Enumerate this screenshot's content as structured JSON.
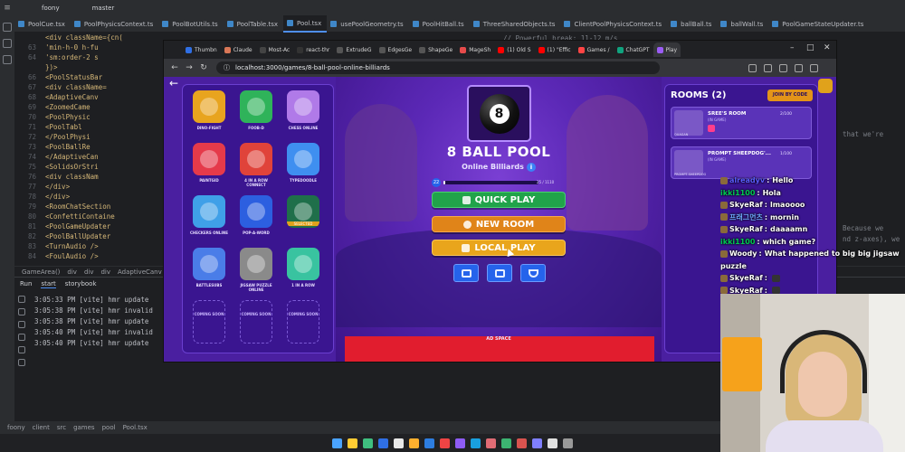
{
  "ide": {
    "project": "foony",
    "branch": "master",
    "tabs": [
      "PoolCue.tsx",
      "PoolPhysicsContext.ts",
      "PoolBotUtils.ts",
      "PoolTable.tsx",
      "Pool.tsx",
      "usePoolGeometry.ts",
      "PoolHitBall.ts",
      "ThreeSharedObjects.ts",
      "ClientPoolPhysicsContext.ts",
      "ballBall.ts",
      "ballWall.ts",
      "PoolGameStateUpdater.ts"
    ],
    "active_tab": "Pool.tsx",
    "code_lines": [
      {
        "n": "",
        "t": "<div className={cn("
      },
      {
        "n": "63",
        "t": "  'min-h-0 h-fu"
      },
      {
        "n": "64",
        "t": "  'sm:order-2 s"
      },
      {
        "n": "",
        "t": "})>"
      },
      {
        "n": "66",
        "t": "  <PoolStatusBar"
      },
      {
        "n": "67",
        "t": "  <div className="
      },
      {
        "n": "68",
        "t": "    <AdaptiveCanv"
      },
      {
        "n": "69",
        "t": "      <ZoomedCame"
      },
      {
        "n": "70",
        "t": "      <PoolPhysic"
      },
      {
        "n": "71",
        "t": "        <PoolTabl"
      },
      {
        "n": "72",
        "t": "      </PoolPhysi"
      },
      {
        "n": "73",
        "t": "      <PoolBallRe"
      },
      {
        "n": "74",
        "t": "    </AdaptiveCan"
      },
      {
        "n": "75",
        "t": "    <SolidsOrStri"
      },
      {
        "n": "76",
        "t": "    <div classNam"
      },
      {
        "n": "77",
        "t": "  </div>"
      },
      {
        "n": "78",
        "t": "</div>"
      },
      {
        "n": "79",
        "t": "<RoomChatSection"
      },
      {
        "n": "80",
        "t": "<ConfettiContaine"
      },
      {
        "n": "81",
        "t": "<PoolGameUpdater"
      },
      {
        "n": "82",
        "t": "<PoolBallUpdater"
      },
      {
        "n": "83",
        "t": "<TurnAudio />"
      },
      {
        "n": "84",
        "t": "<FoulAudio />"
      }
    ],
    "code_comment": "// Powerful break: 11-12 m/s",
    "side_text": [
      "that we're",
      "Because we",
      "nd z-axes), we",
      "s"
    ],
    "breadcrumb": [
      "GameArea()",
      "div",
      "div",
      "div",
      "AdaptiveCanv"
    ],
    "run_tabs": [
      "Run",
      "start",
      "storybook"
    ],
    "log_lines": [
      "3:05:33 PM [vite] hmr update",
      "3:05:38 PM [vite] hmr invalid",
      "3:05:38 PM [vite] hmr update",
      "3:05:40 PM [vite] hmr invalid",
      "3:05:40 PM [vite] hmr update"
    ],
    "status_path": [
      "foony",
      "client",
      "src",
      "games",
      "pool",
      "Pool.tsx"
    ]
  },
  "browser": {
    "tabs": [
      {
        "label": "Thumbn",
        "color": "#2f6fe4"
      },
      {
        "label": "Claude",
        "color": "#d97757"
      },
      {
        "label": "Most-Ac",
        "color": "#444444"
      },
      {
        "label": "react-thr",
        "color": "#333333"
      },
      {
        "label": "ExtrudeG",
        "color": "#555555"
      },
      {
        "label": "EdgesGe",
        "color": "#555555"
      },
      {
        "label": "ShapeGe",
        "color": "#555555"
      },
      {
        "label": "MageSh",
        "color": "#e64b4b"
      },
      {
        "label": "(1) Old S",
        "color": "#ff0000"
      },
      {
        "label": "(1) \"Effic",
        "color": "#ff0000"
      },
      {
        "label": "Games /",
        "color": "#ff4444"
      },
      {
        "label": "ChatGPT",
        "color": "#10a37f"
      },
      {
        "label": "Play",
        "color": "#9b5cf6"
      }
    ],
    "url": "localhost:3000/games/8-ball-pool-online-billiards"
  },
  "game": {
    "title": "8 BALL POOL",
    "subtitle": "Online Billiards",
    "ball_number": "8",
    "level": "22",
    "xp_text": "25 / 1110",
    "xp_fraction": 0.023,
    "quick_play": "QUICK PLAY",
    "new_room": "NEW ROOM",
    "local_play": "LOCAL PLAY",
    "ad_label": "AD SPACE",
    "games": [
      {
        "label": "DINO-FIGHT",
        "color": "#e8a41f"
      },
      {
        "label": "FOOB-D",
        "color": "#2fb35a"
      },
      {
        "label": "CHESS ONLINE",
        "color": "#b07ae8"
      },
      {
        "label": "PAINTGID",
        "color": "#e53a4a"
      },
      {
        "label": "4 IN A ROW CONNECT",
        "color": "#e0433a"
      },
      {
        "label": "TYPEDOODLE",
        "color": "#3f8ff0"
      },
      {
        "label": "CHECKERS ONLINE",
        "color": "#3fa0e8"
      },
      {
        "label": "POP-A-WORD",
        "color": "#2c5fe0"
      },
      {
        "label": "SELECTED",
        "color": "#1f6f4a"
      },
      {
        "label": "BATTLESUBS",
        "color": "#4a7de8"
      },
      {
        "label": "JIGSAW PUZZLE ONLINE",
        "color": "#8a8a8a"
      },
      {
        "label": "1 IN A ROW",
        "color": "#39c3a0"
      }
    ],
    "coming_soon": [
      "COMING SOON",
      "COMING SOON",
      "COMING SOON"
    ]
  },
  "rooms": {
    "title": "ROOMS (2)",
    "join_label": "JOIN BY CODE",
    "items": [
      {
        "name": "SREE'S ROOM",
        "status": "(IN GAME)",
        "count": "2/100",
        "host": "QUAGAN"
      },
      {
        "name": "PROMPT SHEEPDOG'...",
        "status": "(IN GAME)",
        "count": "1/100",
        "host": "PROMPT SHEEPDOG"
      }
    ]
  },
  "chat": [
    {
      "user": "alreadyv",
      "msg": "Hello",
      "color": "#5b5bff"
    },
    {
      "user": "ikki1100",
      "msg": "Hola",
      "color": "#00c853"
    },
    {
      "user": "SkyeRaf",
      "msg": "lmaoooo",
      "color": "#ffffff"
    },
    {
      "user": "프래그먼츠",
      "msg": "mornin",
      "color": "#6fa8ff"
    },
    {
      "user": "SkyeRaf",
      "msg": "daaaamn",
      "color": "#ffffff"
    },
    {
      "user": "ikki1100",
      "msg": "which game?",
      "color": "#00c853"
    },
    {
      "user": "Woody",
      "msg": "What happened to big big jigsaw",
      "color": "#ffffff"
    },
    {
      "user": "",
      "msg": "puzzle",
      "color": "#ffffff"
    },
    {
      "user": "SkyeRaf",
      "msg": "",
      "color": "#ffffff"
    },
    {
      "user": "SkyeRaf",
      "msg": "",
      "color": "#ffffff"
    }
  ]
}
